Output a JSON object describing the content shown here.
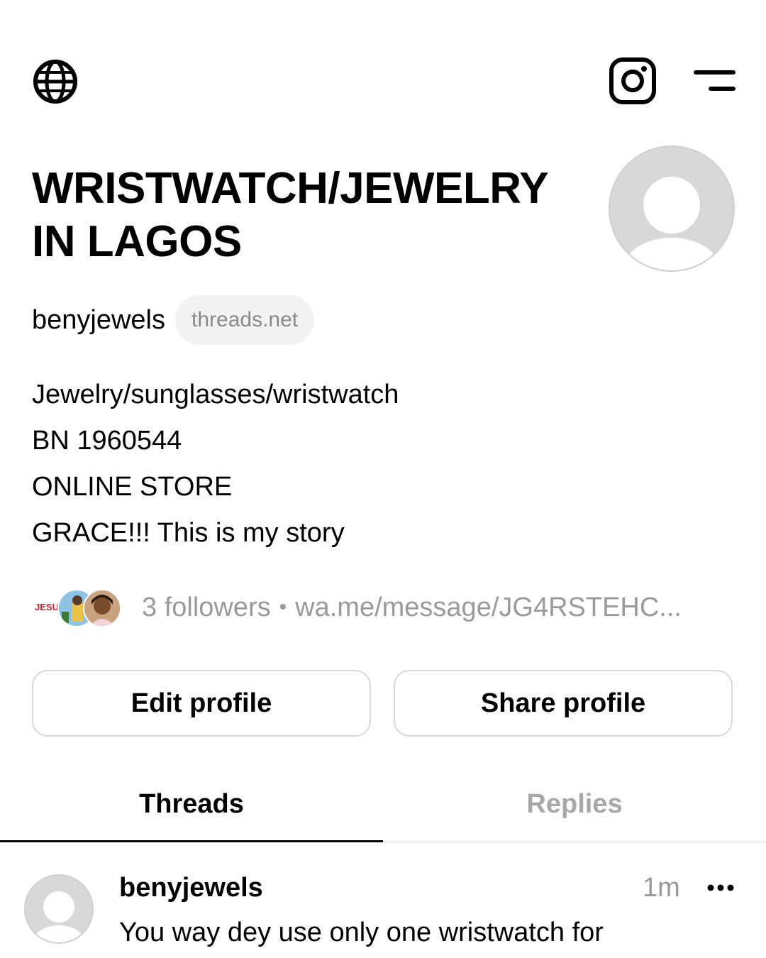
{
  "top_bar": {
    "left_icon": "globe-icon",
    "right_icons": [
      "instagram-icon",
      "menu-icon"
    ]
  },
  "profile": {
    "name_line1": "WRISTWATCH/JEWELRY",
    "name_line2": "IN LAGOS",
    "handle": "benyjewels",
    "domain_badge": "threads.net",
    "bio_lines": [
      "Jewelry/sunglasses/wristwatch",
      "BN 1960544",
      "ONLINE STORE",
      "GRACE!!! This is my story"
    ],
    "followers_label": "3 followers",
    "separator": "•",
    "link": "wa.me/message/JG4RSTEHC...",
    "follower_avatar_1_text": "JESU"
  },
  "actions": {
    "edit_label": "Edit profile",
    "share_label": "Share profile"
  },
  "tabs": [
    {
      "label": "Threads",
      "active": true
    },
    {
      "label": "Replies",
      "active": false
    }
  ],
  "post": {
    "author": "benyjewels",
    "time": "1m",
    "text": "You way dey use only one wristwatch for"
  },
  "colors": {
    "text": "#000000",
    "muted": "#9a9a9a",
    "border": "#d9d9d9",
    "pill_bg": "#f2f2f2",
    "avatar_placeholder": "#d8d8d8"
  }
}
